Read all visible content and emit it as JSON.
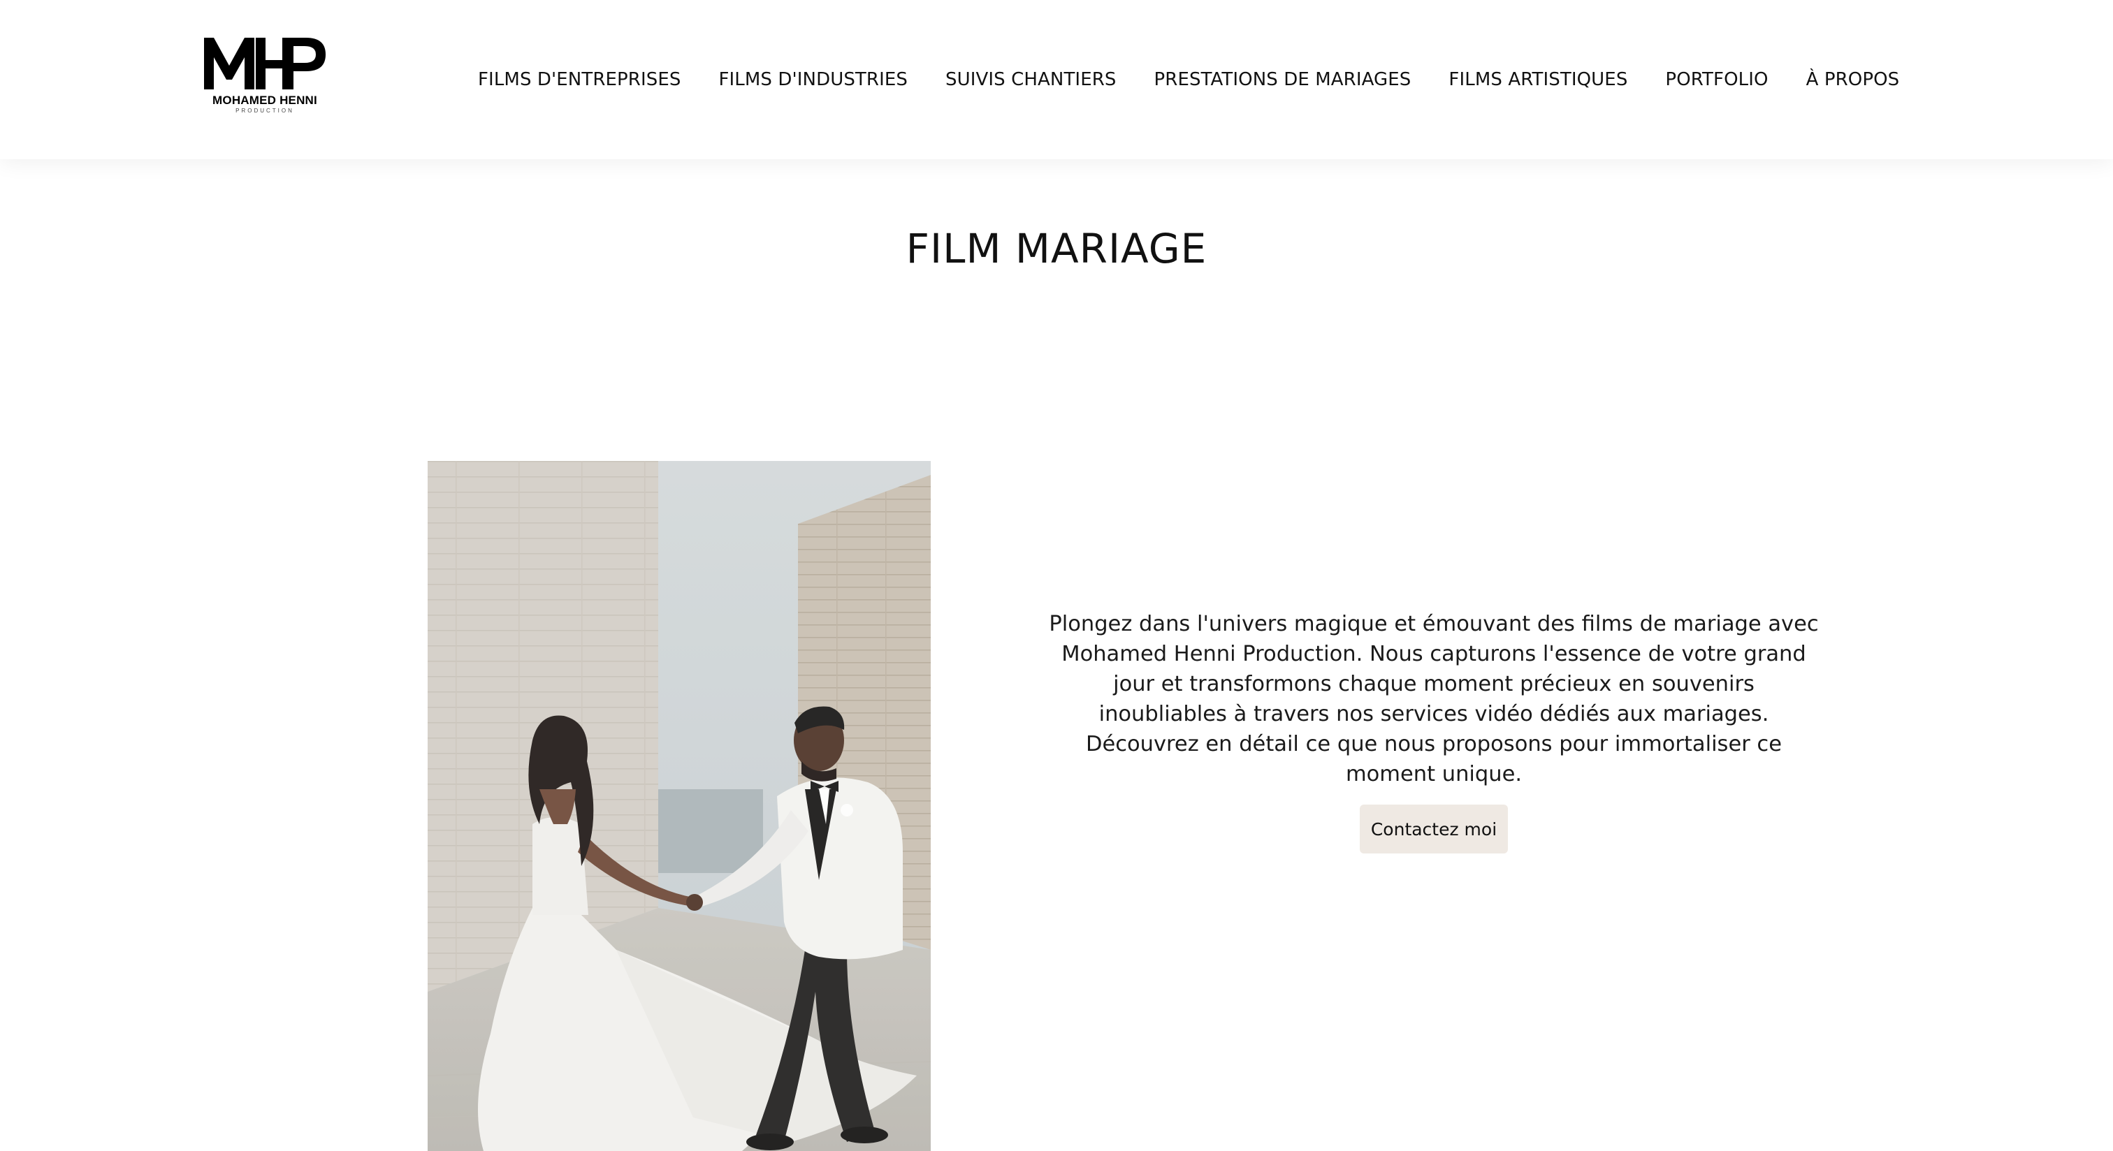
{
  "brand": {
    "name": "MOHAMED HENNI",
    "sub": "PRODUCTION"
  },
  "nav": {
    "items": [
      {
        "label": "FILMS D'ENTREPRISES"
      },
      {
        "label": "FILMS D'INDUSTRIES"
      },
      {
        "label": "SUIVIS CHANTIERS"
      },
      {
        "label": "PRESTATIONS DE MARIAGES"
      },
      {
        "label": "FILMS ARTISTIQUES"
      },
      {
        "label": "PORTFOLIO"
      },
      {
        "label": "À PROPOS"
      }
    ]
  },
  "page": {
    "title": "FILM MARIAGE",
    "intro": "Plongez dans l'univers magique et émouvant des films de mariage avec Mohamed Henni Production. Nous capturons l'essence de votre grand jour et transformons chaque moment précieux en souvenirs inoubliables à travers nos services vidéo dédiés aux mariages. Découvrez en détail ce que nous proposons pour immortaliser ce moment unique.",
    "cta_label": "Contactez moi"
  },
  "colors": {
    "cta_background": "#efe9e3",
    "text": "#111111",
    "background": "#ffffff"
  }
}
